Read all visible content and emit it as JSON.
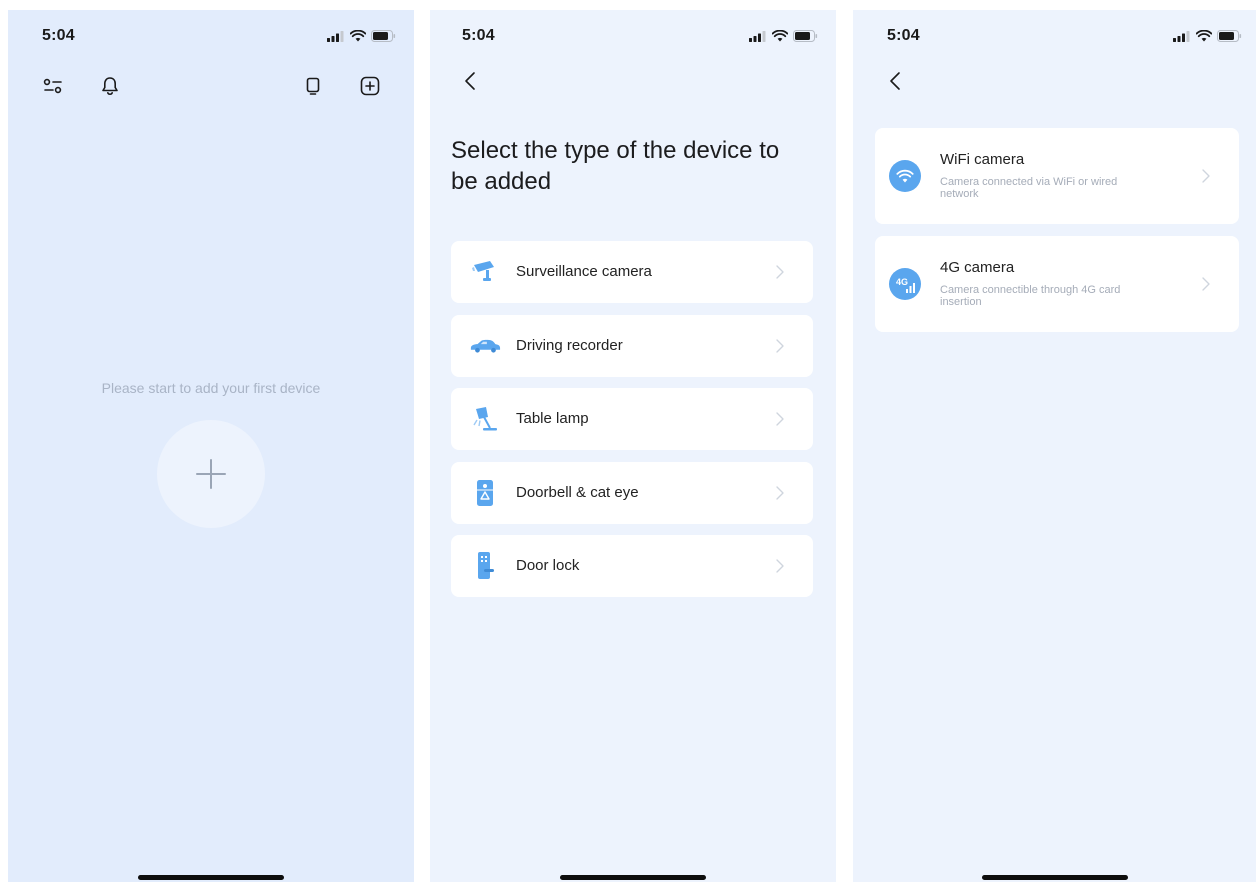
{
  "status_bar": {
    "time": "5:04"
  },
  "home": {
    "empty_message": "Please start to add your first device"
  },
  "device_types": {
    "heading": "Select the type of the device to be added",
    "items": [
      {
        "label": "Surveillance camera",
        "icon": "surveillance-camera-icon"
      },
      {
        "label": "Driving recorder",
        "icon": "car-icon"
      },
      {
        "label": "Table lamp",
        "icon": "table-lamp-icon"
      },
      {
        "label": "Doorbell & cat eye",
        "icon": "doorbell-icon"
      },
      {
        "label": "Door lock",
        "icon": "door-lock-icon"
      }
    ]
  },
  "camera_types": {
    "items": [
      {
        "title": "WiFi camera",
        "description": "Camera connected via WiFi or wired network",
        "icon": "wifi-icon"
      },
      {
        "title": "4G camera",
        "description": "Camera connectible through 4G card insertion",
        "icon": "4g-icon",
        "icon_text": "4G"
      }
    ]
  },
  "colors": {
    "accent": "#5aa6ee",
    "home_background": "#e2ecfc",
    "page_background": "#edf3fd"
  }
}
